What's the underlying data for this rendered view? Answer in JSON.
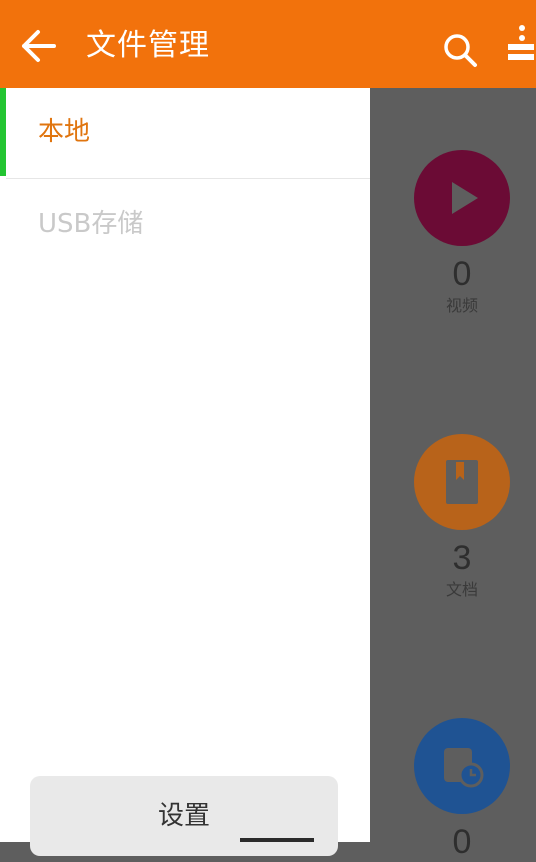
{
  "appbar": {
    "title": "文件管理",
    "back_icon": "back-arrow-icon",
    "search_icon": "search-icon",
    "more_icon": "more-vertical-icon",
    "background_color": "#f2720c"
  },
  "drawer": {
    "items": [
      {
        "label": "本地",
        "selected": true,
        "color": "#e0750f"
      },
      {
        "label": "USB存储",
        "selected": false,
        "color": "#c9c9c9"
      }
    ],
    "settings_label": "设置",
    "selected_indicator_color": "#23c532"
  },
  "categories": [
    {
      "name": "视频",
      "count": "0",
      "icon": "play-icon",
      "color": "#6b0b35"
    },
    {
      "name": "文档",
      "count": "3",
      "icon": "document-icon",
      "color": "#b8631a"
    },
    {
      "name": "",
      "count": "0",
      "icon": "recent-file-clock-icon",
      "color": "#1f5393"
    }
  ]
}
